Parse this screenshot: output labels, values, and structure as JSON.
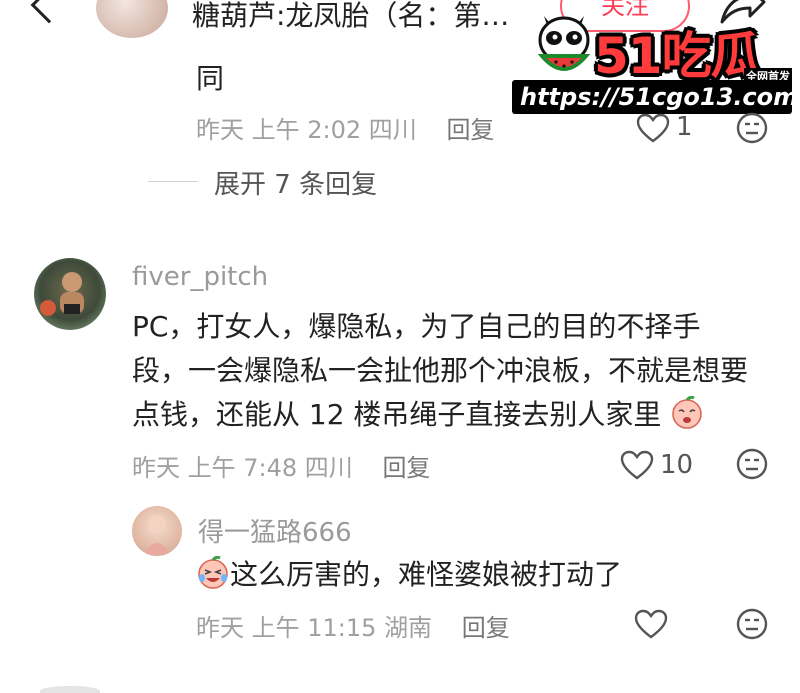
{
  "header": {
    "title": "糖葫芦:龙凤胎（名：第…",
    "follow_label": "关注"
  },
  "watermark": {
    "brand": "51吃瓜",
    "tag": "全网首发",
    "url": "https://51cgo13.com"
  },
  "comment1": {
    "text": "同",
    "time": "昨天 上午 2:02",
    "location": "四川",
    "reply_label": "回复",
    "likes": "1"
  },
  "expand": {
    "label": "展开 7 条回复"
  },
  "comment2": {
    "username": "fiver_pitch",
    "line1": "PC，打女人，爆隐私，为了自己的目的不择手",
    "line2": "段，一会爆隐私一会扯他那个冲浪板，不就是想要",
    "line3": "点钱，还能从 12 楼吊绳子直接去别人家里",
    "time": "昨天 上午 7:48",
    "location": "四川",
    "reply_label": "回复",
    "likes": "10"
  },
  "reply1": {
    "username": "得一猛路666",
    "text": "这么厉害的，难怪婆娘被打动了",
    "time": "昨天 上午 11:15",
    "location": "湖南",
    "reply_label": "回复"
  }
}
